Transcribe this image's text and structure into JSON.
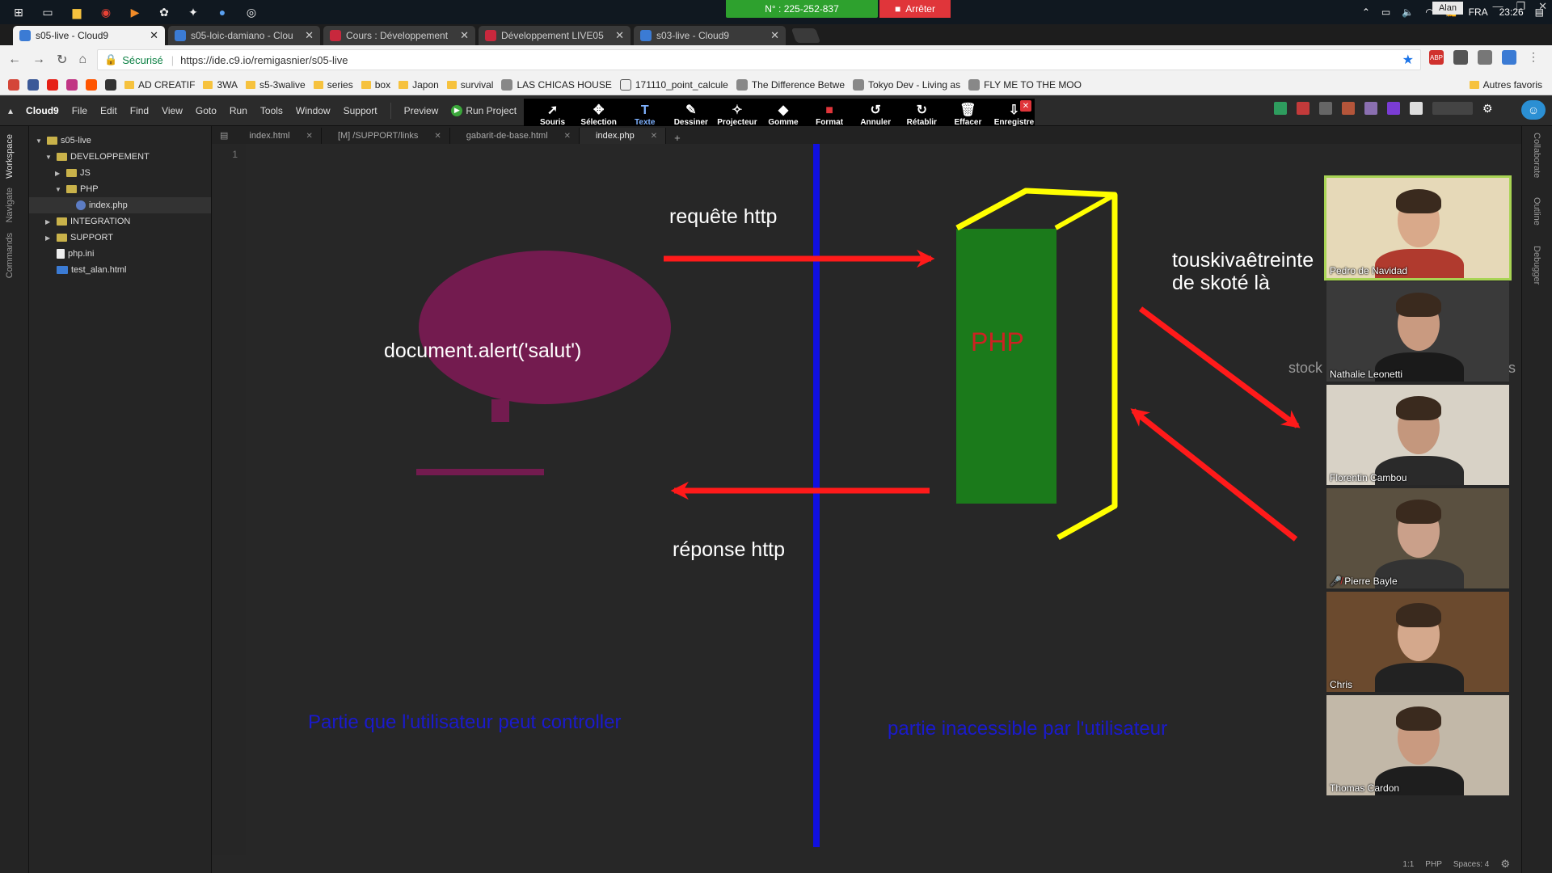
{
  "taskbar": {
    "call_number": "N° : 225-252-837",
    "stop_label": "Arrêter",
    "language": "FRA",
    "time": "23:26"
  },
  "browser": {
    "tabs": [
      {
        "title": "s05-live - Cloud9",
        "color": "#3b7bd4",
        "active": true
      },
      {
        "title": "s05-loic-damiano - Clou",
        "color": "#3b7bd4",
        "active": false
      },
      {
        "title": "Cours : Développement",
        "color": "#c8283d",
        "active": false
      },
      {
        "title": "Développement LIVE05",
        "color": "#c8283d",
        "active": false
      },
      {
        "title": "s03-live - Cloud9",
        "color": "#3b7bd4",
        "active": false
      }
    ],
    "user": "Alan",
    "secure_label": "Sécurisé",
    "url": "https://ide.c9.io/remigasnier/s05-live",
    "bookmarks": [
      {
        "label": "",
        "kind": "gmail"
      },
      {
        "label": "",
        "kind": "facebook"
      },
      {
        "label": "",
        "kind": "youtube"
      },
      {
        "label": "",
        "kind": "instagram"
      },
      {
        "label": "",
        "kind": "soundcloud"
      },
      {
        "label": "",
        "kind": "terminal"
      },
      {
        "label": "AD CREATIF",
        "kind": "folder"
      },
      {
        "label": "3WA",
        "kind": "folder"
      },
      {
        "label": "s5-3walive",
        "kind": "folder"
      },
      {
        "label": "series",
        "kind": "folder"
      },
      {
        "label": "box",
        "kind": "folder"
      },
      {
        "label": "Japon",
        "kind": "folder"
      },
      {
        "label": "survival",
        "kind": "folder"
      },
      {
        "label": "LAS CHICAS HOUSE",
        "kind": "page"
      },
      {
        "label": "171110_point_calcule",
        "kind": "doc"
      },
      {
        "label": "The Difference Betwe",
        "kind": "page"
      },
      {
        "label": "Tokyo Dev - Living as",
        "kind": "page"
      },
      {
        "label": "FLY ME TO THE MOO",
        "kind": "page"
      }
    ],
    "other_bookmarks": "Autres favoris"
  },
  "c9": {
    "menu": [
      "Cloud9",
      "File",
      "Edit",
      "Find",
      "View",
      "Goto",
      "Run",
      "Tools",
      "Window",
      "Support"
    ],
    "preview": "Preview",
    "run_project": "Run Project",
    "draw_tools": [
      {
        "label": "Souris",
        "icon": "cursor-icon",
        "glyph": "➚"
      },
      {
        "label": "Sélection",
        "icon": "move-icon",
        "glyph": "✥"
      },
      {
        "label": "Texte",
        "icon": "text-icon",
        "glyph": "T",
        "active": true
      },
      {
        "label": "Dessiner",
        "icon": "pencil-icon",
        "glyph": "✎"
      },
      {
        "label": "Projecteur",
        "icon": "wand-icon",
        "glyph": "✧"
      },
      {
        "label": "Gomme",
        "icon": "eraser-icon",
        "glyph": "◆"
      },
      {
        "label": "Format",
        "icon": "color-swatch-icon",
        "glyph": "■"
      },
      {
        "label": "Annuler",
        "icon": "undo-icon",
        "glyph": "↺"
      },
      {
        "label": "Rétablir",
        "icon": "redo-icon",
        "glyph": "↻"
      },
      {
        "label": "Effacer",
        "icon": "trash-icon",
        "glyph": "🗑"
      },
      {
        "label": "Enregistre",
        "icon": "save-icon",
        "glyph": "⇩"
      }
    ],
    "left_tabs": [
      "Workspace",
      "Navigate",
      "Commands"
    ],
    "right_tabs": [
      "Collaborate",
      "Outline",
      "Debugger"
    ],
    "tree": [
      {
        "label": "s05-live",
        "depth": 0,
        "type": "folder",
        "open": true
      },
      {
        "label": "DEVELOPPEMENT",
        "depth": 1,
        "type": "folder",
        "open": true
      },
      {
        "label": "JS",
        "depth": 2,
        "type": "folder",
        "open": false
      },
      {
        "label": "PHP",
        "depth": 2,
        "type": "folder",
        "open": true
      },
      {
        "label": "index.php",
        "depth": 3,
        "type": "php",
        "selected": true
      },
      {
        "label": "INTEGRATION",
        "depth": 1,
        "type": "folder",
        "open": false
      },
      {
        "label": "SUPPORT",
        "depth": 1,
        "type": "folder",
        "open": false
      },
      {
        "label": "php.ini",
        "depth": 1,
        "type": "file"
      },
      {
        "label": "test_alan.html",
        "depth": 1,
        "type": "html"
      }
    ],
    "editor_tabs": [
      {
        "label": "index.html",
        "active": false
      },
      {
        "label": "[M] /SUPPORT/links",
        "active": false
      },
      {
        "label": "gabarit-de-base.html",
        "active": false
      },
      {
        "label": "index.php",
        "active": true
      }
    ],
    "line_number": "1",
    "status": {
      "position": "1:1",
      "mode": "PHP",
      "spaces": "Spaces: 4"
    }
  },
  "drawing": {
    "request_label": "requête http",
    "response_label": "réponse http",
    "client_code": "document.alert('salut')",
    "server_label": "PHP",
    "side_note_line1": "touskivaêtreinte",
    "side_note_line2": "de skoté là",
    "hidden_word": "stock",
    "hidden_s": "s",
    "left_caption": "Partie que l'utilisateur peut controller",
    "right_caption": "partie inacessible par l'utilisateur",
    "colors": {
      "divider": "#1010e0",
      "arrow": "#ff1a1a",
      "ellipse": "#731b4f",
      "box_green": "#1b7a1b",
      "box_outline": "#ffff00",
      "php_text": "#cc2222",
      "caption": "#1a1acc"
    }
  },
  "participants": [
    {
      "name": "Pedro de Navidad",
      "speaking": true,
      "bg": "#e6d9b8",
      "skin": "#d9a98a",
      "shirt": "#b03a2e"
    },
    {
      "name": "Nathalie Leonetti",
      "bg": "#3a3a3a",
      "skin": "#c99a80",
      "shirt": "#1a1a1a"
    },
    {
      "name": "Florentin Cambou",
      "bg": "#d8d2c6",
      "skin": "#c4977d",
      "shirt": "#2a2a2a"
    },
    {
      "name": "Pierre Bayle",
      "bg": "#5a5040",
      "skin": "#caa08a",
      "shirt": "#333333",
      "muted": true
    },
    {
      "name": "Chris",
      "bg": "#6b4a2e",
      "skin": "#d4a88c",
      "shirt": "#222222"
    },
    {
      "name": "Thomas Cardon",
      "bg": "#c2b8a8",
      "skin": "#c99a80",
      "shirt": "#1e1e1e"
    }
  ]
}
